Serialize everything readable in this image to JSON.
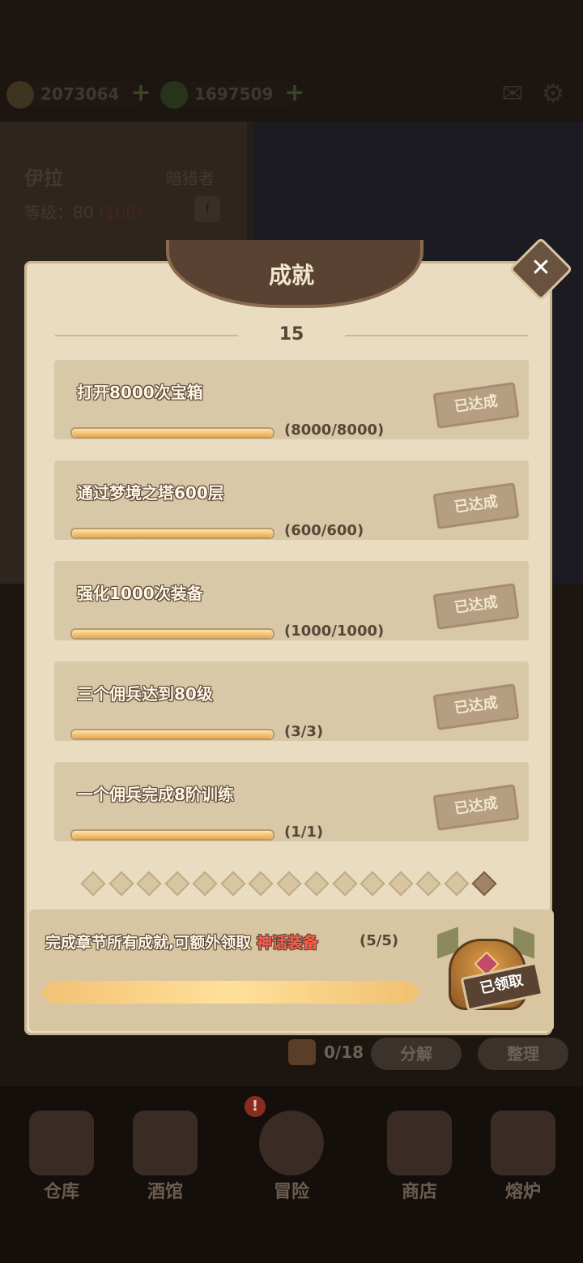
{
  "resources": {
    "gold": "2073064",
    "gems": "1697509",
    "gold_icon": "coin-icon",
    "gem_icon": "green-crystal-icon"
  },
  "top_icons": [
    "mail-icon",
    "gear-icon"
  ],
  "hero": {
    "name": "伊拉",
    "class": "暗猎者",
    "level_label": "等级：",
    "level": "80",
    "level_max": "(100)"
  },
  "achievement_modal": {
    "title": "成就",
    "chapter": "15",
    "close_icon": "close-icon",
    "items": [
      {
        "title": "打开8000次宝箱",
        "progress_text": "(8000/8000)",
        "progress": 1.0,
        "status": "已达成"
      },
      {
        "title": "通过梦境之塔600层",
        "progress_text": "(600/600)",
        "progress": 1.0,
        "status": "已达成"
      },
      {
        "title": "强化1000次装备",
        "progress_text": "(1000/1000)",
        "progress": 1.0,
        "status": "已达成"
      },
      {
        "title": "三个佣兵达到80级",
        "progress_text": "(3/3)",
        "progress": 1.0,
        "status": "已达成"
      },
      {
        "title": "一个佣兵完成8阶训练",
        "progress_text": "(1/1)",
        "progress": 1.0,
        "status": "已达成"
      }
    ],
    "page_dots_total": 15,
    "page_dots_active": 15,
    "chapter_reward": {
      "text_prefix": "完成章节所有成就,可额外领取",
      "highlight": "神话装备",
      "progress_text": "(5/5)",
      "progress": 1.0,
      "status": "已领取",
      "chest_icon": "treasure-chest-icon"
    }
  },
  "inventory_bar": {
    "bag_icon": "bag-icon",
    "count": "0/18",
    "decompose_label": "分解",
    "sort_label": "整理"
  },
  "bottom_nav": [
    {
      "label": "仓库",
      "icon": "warehouse-icon"
    },
    {
      "label": "酒馆",
      "icon": "tavern-icon"
    },
    {
      "label": "冒险",
      "icon": "adventure-icon"
    },
    {
      "label": "商店",
      "icon": "shop-icon"
    },
    {
      "label": "熔炉",
      "icon": "furnace-icon"
    }
  ],
  "adventure_badge": "!",
  "colors": {
    "parchment": "#e9dcc0",
    "card": "#d9c8a7",
    "highlight_red": "#ff5a4a",
    "progress_fill": "#e8a64f"
  }
}
